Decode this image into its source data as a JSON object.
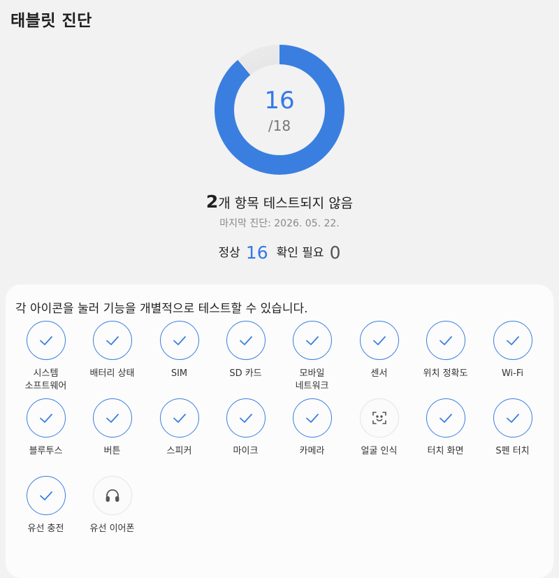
{
  "header": {
    "title": "태블릿 진단"
  },
  "progress": {
    "passed": "16",
    "total_label": "/18",
    "total": 18,
    "accent": "#3a7fe0"
  },
  "summary": {
    "count": "2",
    "text": "개 항목 테스트되지 않음",
    "last_diagnosis": "마지막 진단: 2026. 05. 22."
  },
  "counts": {
    "normal_label": "정상",
    "normal_value": "16",
    "check_label": "확인 필요",
    "check_value": "0"
  },
  "card": {
    "instruction": "각 아이콘을 눌러 기능을 개별적으로 테스트할 수 있습니다."
  },
  "tests": [
    {
      "label": "시스템\n소프트웨어",
      "status": "done",
      "icon": "check-icon"
    },
    {
      "label": "배터리 상태",
      "status": "done",
      "icon": "check-icon"
    },
    {
      "label": "SIM",
      "status": "done",
      "icon": "check-icon"
    },
    {
      "label": "SD 카드",
      "status": "done",
      "icon": "check-icon"
    },
    {
      "label": "모바일\n네트워크",
      "status": "done",
      "icon": "check-icon"
    },
    {
      "label": "센서",
      "status": "done",
      "icon": "check-icon"
    },
    {
      "label": "위치 정확도",
      "status": "done",
      "icon": "check-icon"
    },
    {
      "label": "Wi-Fi",
      "status": "done",
      "icon": "check-icon"
    },
    {
      "label": "블루투스",
      "status": "done",
      "icon": "check-icon"
    },
    {
      "label": "버튼",
      "status": "done",
      "icon": "check-icon"
    },
    {
      "label": "스피커",
      "status": "done",
      "icon": "check-icon"
    },
    {
      "label": "마이크",
      "status": "done",
      "icon": "check-icon"
    },
    {
      "label": "카메라",
      "status": "done",
      "icon": "check-icon"
    },
    {
      "label": "얼굴 인식",
      "status": "pending",
      "icon": "face-scan-icon"
    },
    {
      "label": "터치 화면",
      "status": "done",
      "icon": "check-icon"
    },
    {
      "label": "S펜 터치",
      "status": "done",
      "icon": "check-icon"
    },
    {
      "label": "유선 충전",
      "status": "done",
      "icon": "check-icon"
    },
    {
      "label": "유선 이어폰",
      "status": "pending",
      "icon": "headphones-icon"
    }
  ]
}
